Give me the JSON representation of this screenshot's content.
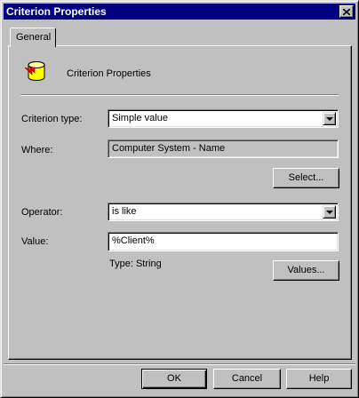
{
  "window": {
    "title": "Criterion Properties",
    "close_label": "×"
  },
  "tabs": [
    {
      "label": "General"
    }
  ],
  "header": {
    "title": "Criterion Properties",
    "icon": "database-cylinder-icon"
  },
  "form": {
    "criterion_type": {
      "label": "Criterion type:",
      "value": "Simple value"
    },
    "where": {
      "label": "Where:",
      "value": "Computer System - Name"
    },
    "select_button": "Select...",
    "operator": {
      "label": "Operator:",
      "value": "is like"
    },
    "value": {
      "label": "Value:",
      "value": "%Client%"
    },
    "type_hint": "Type: String",
    "values_button": "Values..."
  },
  "footer": {
    "ok": "OK",
    "cancel": "Cancel",
    "help": "Help"
  },
  "colors": {
    "title_bar": "#000080",
    "face": "#c0c0c0",
    "icon_body": "#ffff00",
    "icon_arrow": "#ff0000"
  }
}
